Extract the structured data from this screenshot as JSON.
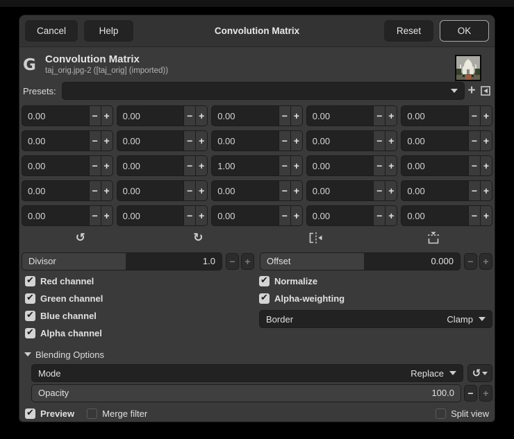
{
  "titlebar": {
    "cancel": "Cancel",
    "help": "Help",
    "title": "Convolution Matrix",
    "reset": "Reset",
    "ok": "OK"
  },
  "header": {
    "logo": "G",
    "title": "Convolution Matrix",
    "subtitle": "taj_orig.jpg-2 ([taj_orig] (imported))"
  },
  "presets": {
    "label": "Presets:",
    "value": ""
  },
  "matrix": {
    "values": [
      [
        "0.00",
        "0.00",
        "0.00",
        "0.00",
        "0.00"
      ],
      [
        "0.00",
        "0.00",
        "0.00",
        "0.00",
        "0.00"
      ],
      [
        "0.00",
        "0.00",
        "1.00",
        "0.00",
        "0.00"
      ],
      [
        "0.00",
        "0.00",
        "0.00",
        "0.00",
        "0.00"
      ],
      [
        "0.00",
        "0.00",
        "0.00",
        "0.00",
        "0.00"
      ]
    ]
  },
  "transform": {
    "icons": [
      "rotate-left",
      "rotate-right",
      "flip-horizontal",
      "flip-vertical"
    ]
  },
  "divisor": {
    "label": "Divisor",
    "value": "1.0",
    "fill_pct": 52
  },
  "offset": {
    "label": "Offset",
    "value": "0.000",
    "fill_pct": 52
  },
  "options": {
    "left": [
      {
        "label": "Red channel",
        "checked": true
      },
      {
        "label": "Green channel",
        "checked": true
      },
      {
        "label": "Blue channel",
        "checked": true
      },
      {
        "label": "Alpha channel",
        "checked": true
      }
    ],
    "right": [
      {
        "label": "Normalize",
        "checked": true
      },
      {
        "label": "Alpha-weighting",
        "checked": true
      }
    ]
  },
  "border": {
    "label": "Border",
    "value": "Clamp"
  },
  "blending": {
    "title": "Blending Options",
    "mode_label": "Mode",
    "mode_value": "Replace",
    "opacity_label": "Opacity",
    "opacity_value": "100.0",
    "opacity_fill_pct": 100
  },
  "footer": {
    "preview": {
      "label": "Preview",
      "checked": true
    },
    "merge": {
      "label": "Merge filter",
      "checked": false
    },
    "split": {
      "label": "Split view",
      "checked": false
    }
  },
  "colors": {
    "dialog_bg": "#3a3a3a",
    "headerbar_bg": "#333333",
    "entry_bg": "#222222",
    "slider_fill": "#3f3f3f",
    "text": "#e0e0e0"
  }
}
